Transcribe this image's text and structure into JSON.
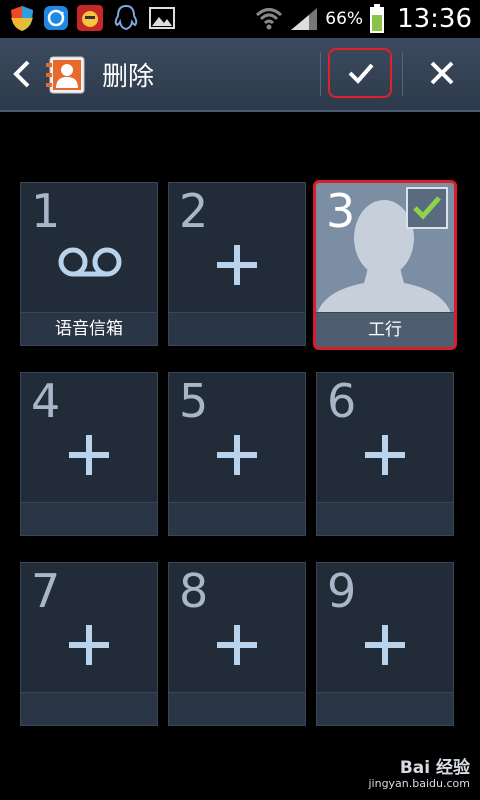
{
  "status_bar": {
    "battery": "66%",
    "time": "13:36",
    "icons": [
      "shield-icon",
      "sync-icon",
      "app-icon",
      "qq-icon",
      "gallery-icon",
      "wifi-icon",
      "signal-icon",
      "battery-icon"
    ]
  },
  "action_bar": {
    "title": "删除",
    "back_icon": "back-chevron-icon",
    "app_icon": "contacts-icon",
    "confirm_icon": "checkmark-icon",
    "cancel_icon": "close-icon"
  },
  "speed_dial": [
    {
      "number": "1",
      "label": "语音信箱",
      "type": "voicemail"
    },
    {
      "number": "2",
      "label": "",
      "type": "empty"
    },
    {
      "number": "3",
      "label": "工行",
      "type": "contact",
      "selected": true
    },
    {
      "number": "4",
      "label": "",
      "type": "empty"
    },
    {
      "number": "5",
      "label": "",
      "type": "empty"
    },
    {
      "number": "6",
      "label": "",
      "type": "empty"
    },
    {
      "number": "7",
      "label": "",
      "type": "empty"
    },
    {
      "number": "8",
      "label": "",
      "type": "empty"
    },
    {
      "number": "9",
      "label": "",
      "type": "empty"
    }
  ],
  "watermark": {
    "line1": "Bai 经验",
    "line2": "jingyan.baidu.com"
  },
  "colors": {
    "accent_red": "#d81e2a",
    "tile_bg": "#222c39",
    "plus": "#b9d3ec"
  }
}
